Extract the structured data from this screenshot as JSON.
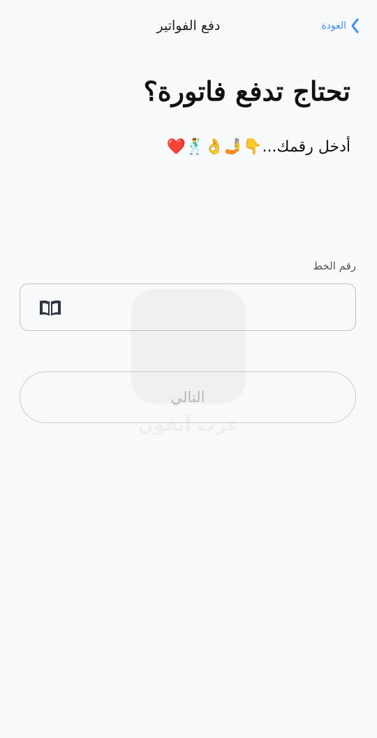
{
  "header": {
    "back_label": "العودة",
    "title": "دفع الفواتير"
  },
  "main": {
    "headline": "تحتاج تدفع فاتورة؟",
    "subline": "أدخل رقمك...👇🤳👌🕺❤️"
  },
  "form": {
    "line_label": "رقم الخط",
    "line_value": "",
    "line_placeholder": ""
  },
  "actions": {
    "next_label": "التالي"
  },
  "watermark": {
    "text": "عرب آيفون"
  },
  "colors": {
    "accent": "#3d8ef7",
    "background": "#f8f9fb"
  }
}
